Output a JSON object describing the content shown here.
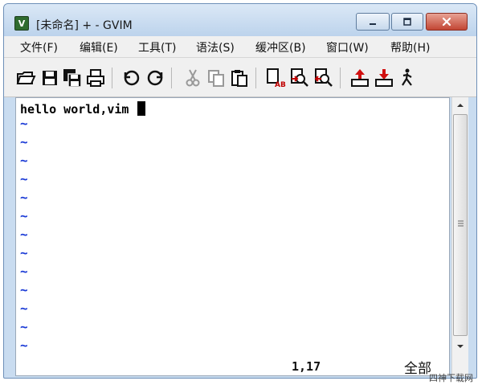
{
  "window": {
    "title": "[未命名] + - GVIM",
    "app_icon_letter": "V"
  },
  "menu": {
    "items": [
      {
        "label": "文件(F)"
      },
      {
        "label": "编辑(E)"
      },
      {
        "label": "工具(T)"
      },
      {
        "label": "语法(S)"
      },
      {
        "label": "缓冲区(B)"
      },
      {
        "label": "窗口(W)"
      },
      {
        "label": "帮助(H)"
      }
    ]
  },
  "toolbar": {
    "buttons": [
      "open-icon",
      "save-icon",
      "save-all-icon",
      "print-icon",
      "undo-icon",
      "redo-icon",
      "cut-icon",
      "copy-icon",
      "paste-icon",
      "find-replace-icon",
      "find-next-icon",
      "find-prev-icon",
      "load-session-icon",
      "save-session-icon",
      "run-script-icon"
    ]
  },
  "editor": {
    "text_line": "hello world,vim ",
    "tilde": "~",
    "ruler_position": "1,17",
    "ruler_percent": "全部"
  },
  "watermark": {
    "text": "四神下载网"
  },
  "colors": {
    "tilde": "#1b3bd6",
    "close_button": "#c24634",
    "titlebar": "#c9dcf0"
  }
}
